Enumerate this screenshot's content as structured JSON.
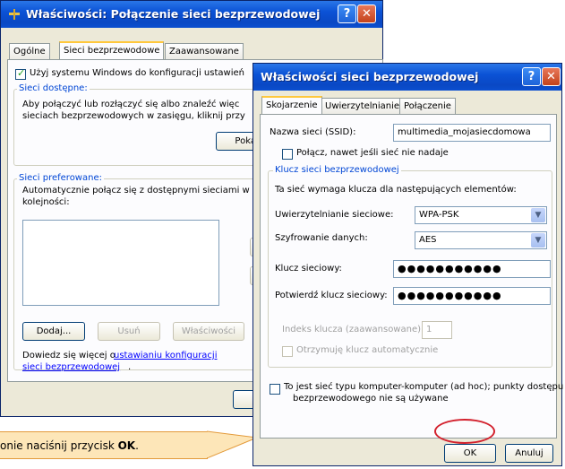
{
  "back_window": {
    "title": "Właściwości: Połączenie sieci bezprzewodowej",
    "tabs": [
      "Ogólne",
      "Sieci bezprzewodowe",
      "Zaawansowane"
    ],
    "use_windows_checkbox": "Użyj systemu Windows do konfiguracji ustawień",
    "available": {
      "group_label": "Sieci dostępne:",
      "desc_line1": "Aby połączyć lub rozłączyć się albo znaleźć więc",
      "desc_line2": "sieciach bezprzewodowych w zasięgu, kliknij przy",
      "show_button": "Pokaż s"
    },
    "preferred": {
      "group_label": "Sieci preferowane:",
      "desc_line1": "Automatycznie połącz się z dostępnymi sieciami w",
      "desc_line2": "kolejności:"
    },
    "buttons": {
      "add": "Dodaj...",
      "remove": "Usuń",
      "properties": "Właściwości"
    },
    "learn_more_prefix": "Dowiedz się więcej o ",
    "learn_more_link_1": "ustawianiu konfiguracji",
    "learn_more_link_2": "sieci bezprzewodowej",
    "learn_more_suffix": "."
  },
  "front_window": {
    "title": "Właściwości sieci bezprzewodowej",
    "tabs": [
      "Skojarzenie",
      "Uwierzytelnianie",
      "Połączenie"
    ],
    "ssid_label": "Nazwa sieci (SSID):",
    "ssid_value": "multimedia_mojasiecdomowa",
    "connect_hidden_label": "Połącz, nawet jeśli sieć nie nadaje",
    "key_group_label": "Klucz sieci bezprzewodowej",
    "key_required_label": "Ta sieć wymaga klucza dla następujących elementów:",
    "auth_label": "Uwierzytelnianie sieciowe:",
    "auth_value": "WPA-PSK",
    "encryption_label": "Szyfrowanie danych:",
    "encryption_value": "AES",
    "key_label": "Klucz sieciowy:",
    "key_value": "●●●●●●●●●●●",
    "confirm_key_label": "Potwierdź klucz sieciowy:",
    "confirm_key_value": "●●●●●●●●●●●",
    "key_index_label": "Indeks klucza (zaawansowane):",
    "key_index_value": "1",
    "auto_key_label": "Otrzymuję klucz automatycznie",
    "adhoc_line1": "To jest sieć typu komputer-komputer (ad hoc); punkty dostępu",
    "adhoc_line2": "bezprzewodowego nie są używane",
    "ok": "OK",
    "cancel": "Anuluj"
  },
  "callout": {
    "text_prefix": "onie naciśnij przycisk ",
    "text_bold": "OK",
    "text_suffix": "."
  },
  "colors": {
    "title_blue": "#0a48c4",
    "callout_fill": "#fde6b8",
    "highlight_ring": "#d3212d"
  }
}
